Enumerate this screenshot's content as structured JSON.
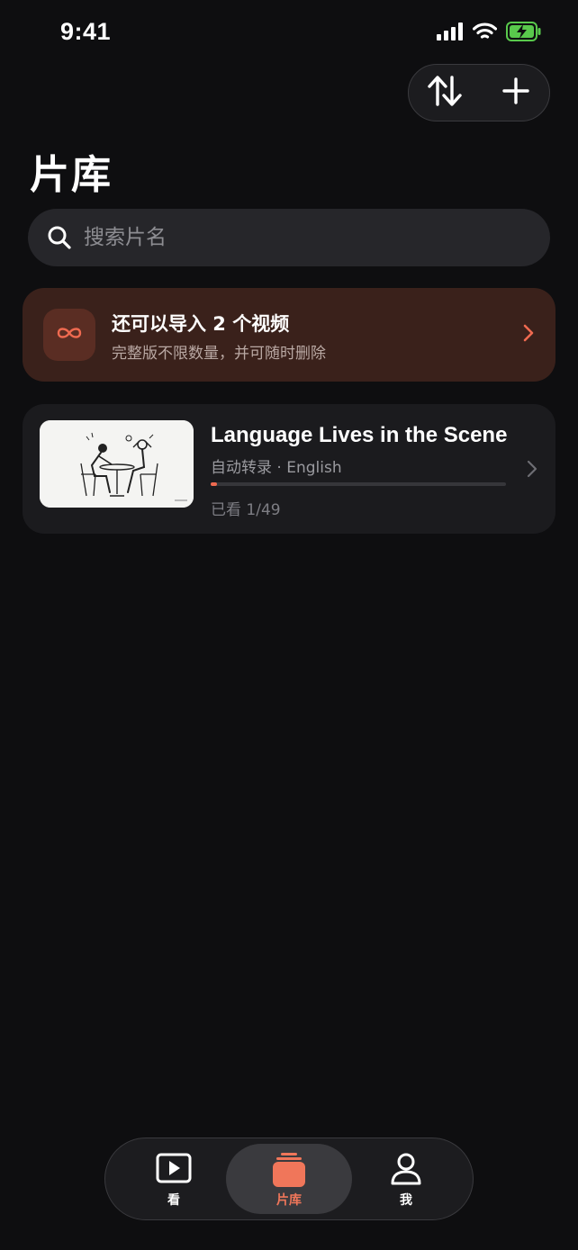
{
  "status_bar": {
    "time": "9:41"
  },
  "top_actions": {
    "sort_icon": "sort-arrows-icon",
    "add_icon": "plus-icon"
  },
  "page": {
    "title": "片库"
  },
  "search": {
    "placeholder": "搜索片名",
    "value": ""
  },
  "promo": {
    "icon": "infinity-icon",
    "title": "还可以导入 2 个视频",
    "subtitle": "完整版不限数量，并可随时删除"
  },
  "videos": [
    {
      "title": "Language Lives in the Scene",
      "meta": "自动转录 · English",
      "watched": "已看 1/49",
      "progress": 0.0204
    }
  ],
  "tabbar": {
    "items": [
      {
        "label": "看",
        "icon": "play-screen-icon",
        "active": false
      },
      {
        "label": "片库",
        "icon": "library-stack-icon",
        "active": true
      },
      {
        "label": "我",
        "icon": "person-icon",
        "active": false
      }
    ]
  },
  "colors": {
    "accent": "#f0765a",
    "promo_bg": "#3a211b",
    "background": "#0e0e10"
  }
}
